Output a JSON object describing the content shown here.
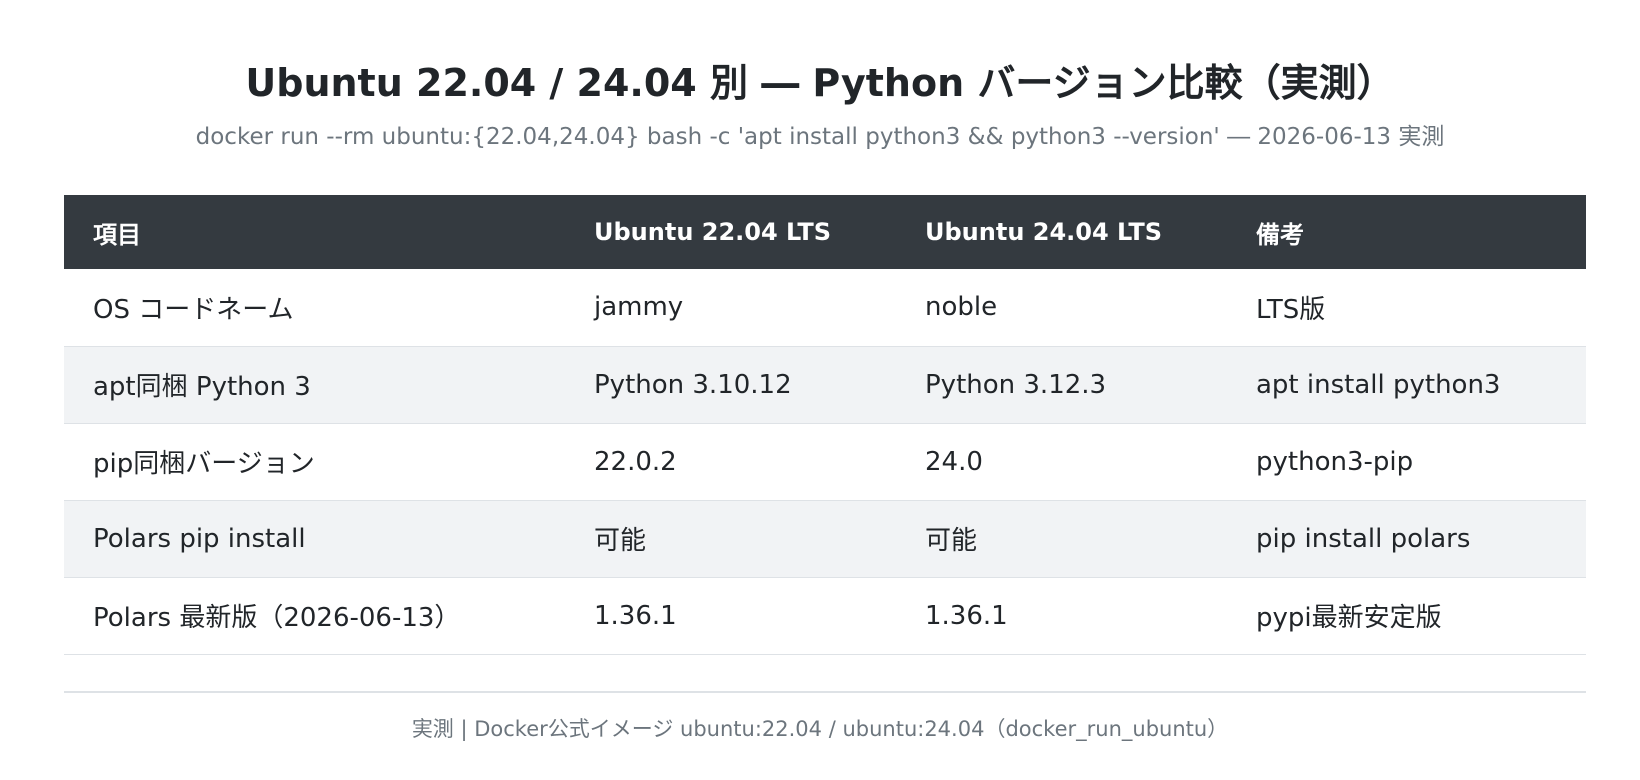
{
  "title": "Ubuntu 22.04 / 24.04 別 ― Python バージョン比較（実測）",
  "subtitle": "docker run --rm ubuntu:{22.04,24.04} bash -c 'apt install python3 && python3 --version' ― 2026-06-13 実測",
  "table": {
    "headers": [
      "項目",
      "Ubuntu 22.04 LTS",
      "Ubuntu 24.04 LTS",
      "備考"
    ],
    "rows": [
      [
        "OS コードネーム",
        "jammy",
        "noble",
        "LTS版"
      ],
      [
        "apt同梱 Python 3",
        "Python 3.10.12",
        "Python 3.12.3",
        "apt install python3"
      ],
      [
        "pip同梱バージョン",
        "22.0.2",
        "24.0",
        "python3-pip"
      ],
      [
        "Polars pip install",
        "可能",
        "可能",
        "pip install polars"
      ],
      [
        "Polars 最新版（2026-06-13）",
        "1.36.1",
        "1.36.1",
        "pypi最新安定版"
      ]
    ]
  },
  "footer": "実測 | Docker公式イメージ ubuntu:22.04 / ubuntu:24.04（docker_run_ubuntu）",
  "colors": {
    "header_bg": "#343a40",
    "header_text": "#ffffff",
    "alt_row_bg": "#f1f3f5",
    "muted_text": "#6c757d",
    "border": "#dee2e6"
  }
}
